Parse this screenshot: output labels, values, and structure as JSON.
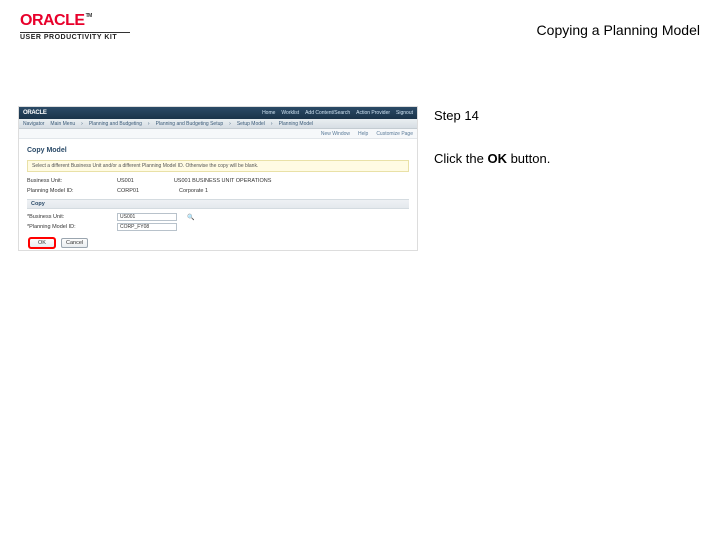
{
  "header": {
    "brand": "ORACLE",
    "sub_brand": "USER PRODUCTIVITY KIT",
    "doc_title": "Copying a Planning Model"
  },
  "instruction": {
    "step_label": "Step 14",
    "prefix": "Click the ",
    "bold": "OK",
    "suffix": " button."
  },
  "screenshot": {
    "brand": "ORACLE",
    "top_links": [
      "Home",
      "Worklist",
      "Add Content/Search",
      "Action Provider",
      "Signout"
    ],
    "nav_items": [
      "Navigator",
      "Main Menu",
      "Planning and Budgeting",
      "Planning and Budgeting Setup",
      "Setup Model",
      "Planning Model"
    ],
    "sub_links": [
      "New Window",
      "Help",
      "Customize Page"
    ],
    "page_title": "Copy Model",
    "tip_text": "Select a different Business Unit and/or a different Planning Model ID. Otherwise the copy will be blank.",
    "rows": [
      {
        "label": "Business Unit:",
        "value": "US001",
        "value2": "US001 BUSINESS UNIT OPERATIONS"
      },
      {
        "label": "Planning Model ID:",
        "value": "CORP01",
        "value2": "Corporate 1"
      }
    ],
    "section": "Copy",
    "inputs": [
      {
        "label": "*Business Unit:",
        "value": "US001"
      },
      {
        "label": "*Planning Model ID:",
        "value": "CORP_FY08"
      }
    ],
    "buttons": {
      "ok": "OK",
      "cancel": "Cancel"
    }
  }
}
